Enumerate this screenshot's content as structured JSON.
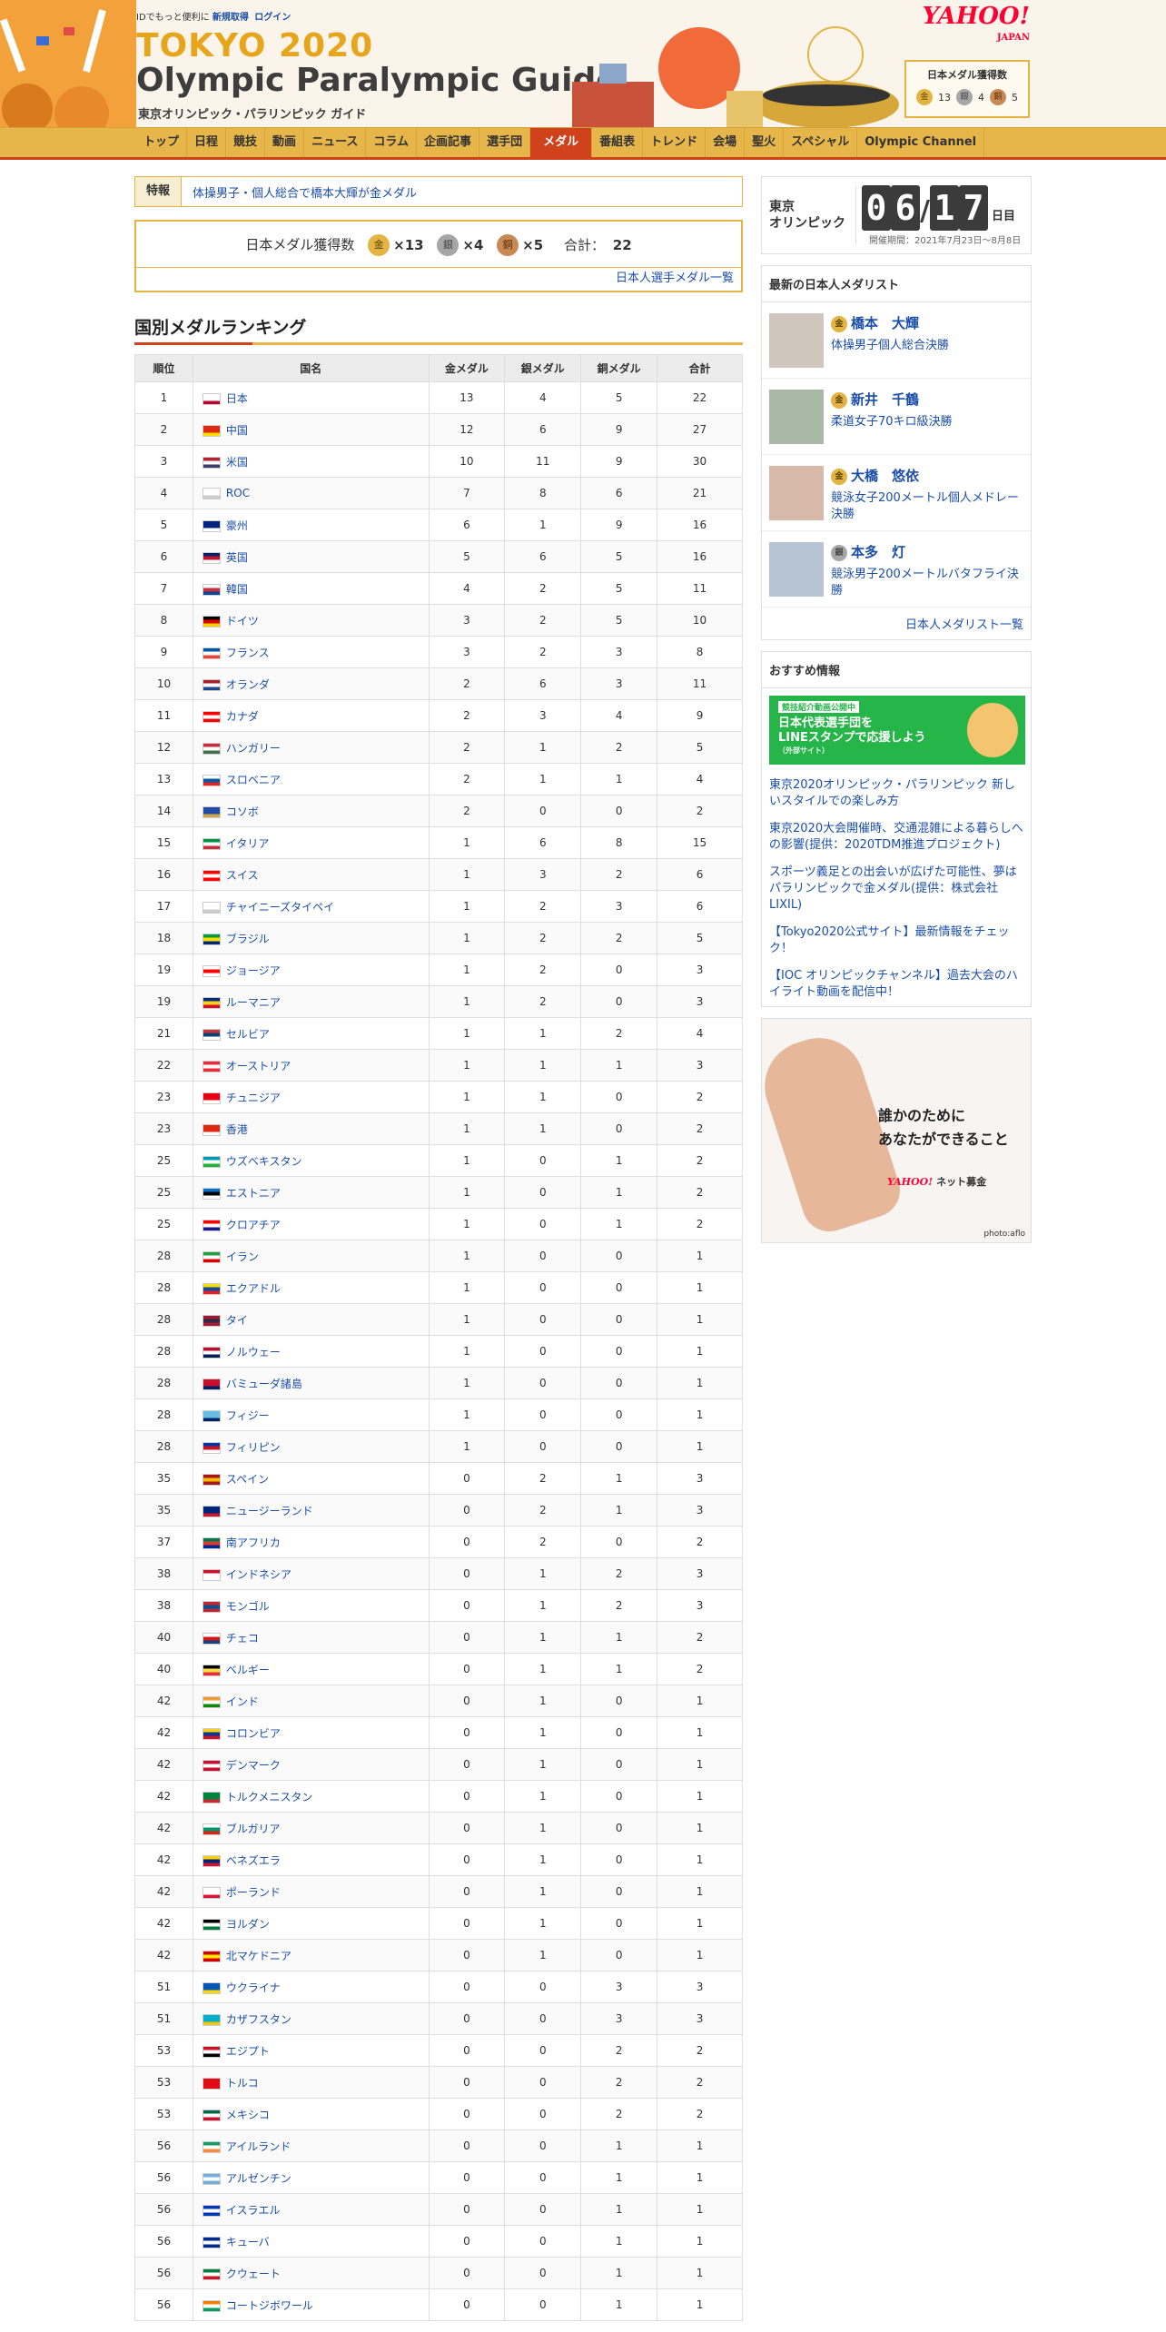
{
  "header": {
    "id_text": "IDでもっと便利に",
    "signup": "新規取得",
    "login": "ログイン",
    "logo_line1": "TOKYO 2020",
    "logo_line2": "Olympic Paralympic Guide",
    "logo_sub": "東京オリンピック・パラリンピック ガイド",
    "yahoo": "YAHOO!",
    "yahoo_sub": "JAPAN",
    "medal_title": "日本メダル獲得数",
    "gold": "13",
    "silver": "4",
    "bronze": "5"
  },
  "nav": [
    {
      "label": "トップ"
    },
    {
      "label": "日程"
    },
    {
      "label": "競技"
    },
    {
      "label": "動画"
    },
    {
      "label": "ニュース"
    },
    {
      "label": "コラム"
    },
    {
      "label": "企画記事"
    },
    {
      "label": "選手団"
    },
    {
      "label": "メダル",
      "active": true
    },
    {
      "label": "番組表"
    },
    {
      "label": "トレンド"
    },
    {
      "label": "会場"
    },
    {
      "label": "聖火"
    },
    {
      "label": "スペシャル"
    },
    {
      "label": "Olympic Channel"
    }
  ],
  "main": {
    "tokuhou_label": "特報",
    "tokuhou_text": "体操男子・個人総合で橋本大輝が金メダル",
    "medal_box": {
      "title": "日本メダル獲得数",
      "gold": "×13",
      "silver": "×4",
      "bronze": "×5",
      "total_label": "合計：",
      "total": "22",
      "link": "日本人選手メダル一覧"
    },
    "ranking_title": "国別メダルランキング",
    "columns": [
      "順位",
      "国名",
      "金メダル",
      "銀メダル",
      "銅メダル",
      "合計"
    ],
    "rows": [
      {
        "rank": "1",
        "name": "日本",
        "g": "13",
        "s": "4",
        "b": "5",
        "t": "22",
        "flag": [
          "#ffffff",
          "#ffffff",
          "#bc002d"
        ]
      },
      {
        "rank": "2",
        "name": "中国",
        "g": "12",
        "s": "6",
        "b": "9",
        "t": "27",
        "flag": [
          "#de2910",
          "#de2910",
          "#ffde00"
        ]
      },
      {
        "rank": "3",
        "name": "米国",
        "g": "10",
        "s": "11",
        "b": "9",
        "t": "30",
        "flag": [
          "#b22234",
          "#ffffff",
          "#3c3b6e"
        ]
      },
      {
        "rank": "4",
        "name": "ROC",
        "g": "7",
        "s": "8",
        "b": "6",
        "t": "21",
        "flag": [
          "#ffffff",
          "#ffffff",
          "#cccccc"
        ]
      },
      {
        "rank": "5",
        "name": "豪州",
        "g": "6",
        "s": "1",
        "b": "9",
        "t": "16",
        "flag": [
          "#00247d",
          "#00247d",
          "#ffffff"
        ]
      },
      {
        "rank": "6",
        "name": "英国",
        "g": "5",
        "s": "6",
        "b": "5",
        "t": "16",
        "flag": [
          "#012169",
          "#c8102e",
          "#ffffff"
        ]
      },
      {
        "rank": "7",
        "name": "韓国",
        "g": "4",
        "s": "2",
        "b": "5",
        "t": "11",
        "flag": [
          "#ffffff",
          "#cd2e3a",
          "#0047a0"
        ]
      },
      {
        "rank": "8",
        "name": "ドイツ",
        "g": "3",
        "s": "2",
        "b": "5",
        "t": "10",
        "flag": [
          "#000000",
          "#dd0000",
          "#ffce00"
        ]
      },
      {
        "rank": "9",
        "name": "フランス",
        "g": "3",
        "s": "2",
        "b": "3",
        "t": "8",
        "flag": [
          "#0055a4",
          "#ffffff",
          "#ef4135"
        ]
      },
      {
        "rank": "10",
        "name": "オランダ",
        "g": "2",
        "s": "6",
        "b": "3",
        "t": "11",
        "flag": [
          "#ae1c28",
          "#ffffff",
          "#21468b"
        ]
      },
      {
        "rank": "11",
        "name": "カナダ",
        "g": "2",
        "s": "3",
        "b": "4",
        "t": "9",
        "flag": [
          "#ff0000",
          "#ffffff",
          "#ff0000"
        ]
      },
      {
        "rank": "12",
        "name": "ハンガリー",
        "g": "2",
        "s": "1",
        "b": "2",
        "t": "5",
        "flag": [
          "#cd2a3e",
          "#ffffff",
          "#436f4d"
        ]
      },
      {
        "rank": "13",
        "name": "スロベニア",
        "g": "2",
        "s": "1",
        "b": "1",
        "t": "4",
        "flag": [
          "#ffffff",
          "#005da4",
          "#ed1c24"
        ]
      },
      {
        "rank": "14",
        "name": "コソボ",
        "g": "2",
        "s": "0",
        "b": "0",
        "t": "2",
        "flag": [
          "#244aa5",
          "#244aa5",
          "#d0a650"
        ]
      },
      {
        "rank": "15",
        "name": "イタリア",
        "g": "1",
        "s": "6",
        "b": "8",
        "t": "15",
        "flag": [
          "#009246",
          "#ffffff",
          "#ce2b37"
        ]
      },
      {
        "rank": "16",
        "name": "スイス",
        "g": "1",
        "s": "3",
        "b": "2",
        "t": "6",
        "flag": [
          "#ff0000",
          "#ffffff",
          "#ff0000"
        ]
      },
      {
        "rank": "17",
        "name": "チャイニーズタイペイ",
        "g": "1",
        "s": "2",
        "b": "3",
        "t": "6",
        "flag": [
          "#ffffff",
          "#ffffff",
          "#cccccc"
        ]
      },
      {
        "rank": "18",
        "name": "ブラジル",
        "g": "1",
        "s": "2",
        "b": "2",
        "t": "5",
        "flag": [
          "#009c3b",
          "#ffdf00",
          "#002776"
        ]
      },
      {
        "rank": "19",
        "name": "ジョージア",
        "g": "1",
        "s": "2",
        "b": "0",
        "t": "3",
        "flag": [
          "#ffffff",
          "#ff0000",
          "#ffffff"
        ]
      },
      {
        "rank": "19",
        "name": "ルーマニア",
        "g": "1",
        "s": "2",
        "b": "0",
        "t": "3",
        "flag": [
          "#002b7f",
          "#fcd116",
          "#ce1126"
        ]
      },
      {
        "rank": "21",
        "name": "セルビア",
        "g": "1",
        "s": "1",
        "b": "2",
        "t": "4",
        "flag": [
          "#c6363c",
          "#0c4076",
          "#ffffff"
        ]
      },
      {
        "rank": "22",
        "name": "オーストリア",
        "g": "1",
        "s": "1",
        "b": "1",
        "t": "3",
        "flag": [
          "#ed2939",
          "#ffffff",
          "#ed2939"
        ]
      },
      {
        "rank": "23",
        "name": "チュニジア",
        "g": "1",
        "s": "1",
        "b": "0",
        "t": "2",
        "flag": [
          "#e70013",
          "#e70013",
          "#ffffff"
        ]
      },
      {
        "rank": "23",
        "name": "香港",
        "g": "1",
        "s": "1",
        "b": "0",
        "t": "2",
        "flag": [
          "#de2910",
          "#de2910",
          "#ffffff"
        ]
      },
      {
        "rank": "25",
        "name": "ウズベキスタン",
        "g": "1",
        "s": "0",
        "b": "1",
        "t": "2",
        "flag": [
          "#0099b5",
          "#ffffff",
          "#1eb53a"
        ]
      },
      {
        "rank": "25",
        "name": "エストニア",
        "g": "1",
        "s": "0",
        "b": "1",
        "t": "2",
        "flag": [
          "#0072ce",
          "#000000",
          "#ffffff"
        ]
      },
      {
        "rank": "25",
        "name": "クロアチア",
        "g": "1",
        "s": "0",
        "b": "1",
        "t": "2",
        "flag": [
          "#ff0000",
          "#ffffff",
          "#171796"
        ]
      },
      {
        "rank": "28",
        "name": "イラン",
        "g": "1",
        "s": "0",
        "b": "0",
        "t": "1",
        "flag": [
          "#239f40",
          "#ffffff",
          "#da0000"
        ]
      },
      {
        "rank": "28",
        "name": "エクアドル",
        "g": "1",
        "s": "0",
        "b": "0",
        "t": "1",
        "flag": [
          "#ffdd00",
          "#034ea2",
          "#ed1c24"
        ]
      },
      {
        "rank": "28",
        "name": "タイ",
        "g": "1",
        "s": "0",
        "b": "0",
        "t": "1",
        "flag": [
          "#a51931",
          "#2d2a4a",
          "#a51931"
        ]
      },
      {
        "rank": "28",
        "name": "ノルウェー",
        "g": "1",
        "s": "0",
        "b": "0",
        "t": "1",
        "flag": [
          "#ba0c2f",
          "#ffffff",
          "#00205b"
        ]
      },
      {
        "rank": "28",
        "name": "バミューダ諸島",
        "g": "1",
        "s": "0",
        "b": "0",
        "t": "1",
        "flag": [
          "#c8102e",
          "#c8102e",
          "#012169"
        ]
      },
      {
        "rank": "28",
        "name": "フィジー",
        "g": "1",
        "s": "0",
        "b": "0",
        "t": "1",
        "flag": [
          "#68bfe5",
          "#68bfe5",
          "#012169"
        ]
      },
      {
        "rank": "28",
        "name": "フィリピン",
        "g": "1",
        "s": "0",
        "b": "0",
        "t": "1",
        "flag": [
          "#0038a8",
          "#ce1126",
          "#ffffff"
        ]
      },
      {
        "rank": "35",
        "name": "スペイン",
        "g": "0",
        "s": "2",
        "b": "1",
        "t": "3",
        "flag": [
          "#aa151b",
          "#f1bf00",
          "#aa151b"
        ]
      },
      {
        "rank": "35",
        "name": "ニュージーランド",
        "g": "0",
        "s": "2",
        "b": "1",
        "t": "3",
        "flag": [
          "#00247d",
          "#00247d",
          "#cc142b"
        ]
      },
      {
        "rank": "37",
        "name": "南アフリカ",
        "g": "0",
        "s": "2",
        "b": "0",
        "t": "2",
        "flag": [
          "#007a4d",
          "#de3831",
          "#002395"
        ]
      },
      {
        "rank": "38",
        "name": "インドネシア",
        "g": "0",
        "s": "1",
        "b": "2",
        "t": "3",
        "flag": [
          "#ce1126",
          "#ffffff",
          "#ffffff"
        ]
      },
      {
        "rank": "38",
        "name": "モンゴル",
        "g": "0",
        "s": "1",
        "b": "2",
        "t": "3",
        "flag": [
          "#c4272f",
          "#015197",
          "#c4272f"
        ]
      },
      {
        "rank": "40",
        "name": "チェコ",
        "g": "0",
        "s": "1",
        "b": "1",
        "t": "2",
        "flag": [
          "#ffffff",
          "#d7141a",
          "#11457e"
        ]
      },
      {
        "rank": "40",
        "name": "ベルギー",
        "g": "0",
        "s": "1",
        "b": "1",
        "t": "2",
        "flag": [
          "#000000",
          "#fae042",
          "#ed2939"
        ]
      },
      {
        "rank": "42",
        "name": "インド",
        "g": "0",
        "s": "1",
        "b": "0",
        "t": "1",
        "flag": [
          "#ff9933",
          "#ffffff",
          "#138808"
        ]
      },
      {
        "rank": "42",
        "name": "コロンビア",
        "g": "0",
        "s": "1",
        "b": "0",
        "t": "1",
        "flag": [
          "#fcd116",
          "#003893",
          "#ce1126"
        ]
      },
      {
        "rank": "42",
        "name": "デンマーク",
        "g": "0",
        "s": "1",
        "b": "0",
        "t": "1",
        "flag": [
          "#c8102e",
          "#ffffff",
          "#c8102e"
        ]
      },
      {
        "rank": "42",
        "name": "トルクメニスタン",
        "g": "0",
        "s": "1",
        "b": "0",
        "t": "1",
        "flag": [
          "#00843d",
          "#00843d",
          "#d22630"
        ]
      },
      {
        "rank": "42",
        "name": "ブルガリア",
        "g": "0",
        "s": "1",
        "b": "0",
        "t": "1",
        "flag": [
          "#ffffff",
          "#00966e",
          "#d62612"
        ]
      },
      {
        "rank": "42",
        "name": "ベネズエラ",
        "g": "0",
        "s": "1",
        "b": "0",
        "t": "1",
        "flag": [
          "#ffcc00",
          "#00247d",
          "#cf142b"
        ]
      },
      {
        "rank": "42",
        "name": "ポーランド",
        "g": "0",
        "s": "1",
        "b": "0",
        "t": "1",
        "flag": [
          "#ffffff",
          "#ffffff",
          "#dc143c"
        ]
      },
      {
        "rank": "42",
        "name": "ヨルダン",
        "g": "0",
        "s": "1",
        "b": "0",
        "t": "1",
        "flag": [
          "#000000",
          "#ffffff",
          "#007a3d"
        ]
      },
      {
        "rank": "42",
        "name": "北マケドニア",
        "g": "0",
        "s": "1",
        "b": "0",
        "t": "1",
        "flag": [
          "#d20000",
          "#ffe600",
          "#d20000"
        ]
      },
      {
        "rank": "51",
        "name": "ウクライナ",
        "g": "0",
        "s": "0",
        "b": "3",
        "t": "3",
        "flag": [
          "#0057b7",
          "#0057b7",
          "#ffd700"
        ]
      },
      {
        "rank": "51",
        "name": "カザフスタン",
        "g": "0",
        "s": "0",
        "b": "3",
        "t": "3",
        "flag": [
          "#00afca",
          "#00afca",
          "#fec50c"
        ]
      },
      {
        "rank": "53",
        "name": "エジプト",
        "g": "0",
        "s": "0",
        "b": "2",
        "t": "2",
        "flag": [
          "#ce1126",
          "#ffffff",
          "#000000"
        ]
      },
      {
        "rank": "53",
        "name": "トルコ",
        "g": "0",
        "s": "0",
        "b": "2",
        "t": "2",
        "flag": [
          "#e30a17",
          "#e30a17",
          "#e30a17"
        ]
      },
      {
        "rank": "53",
        "name": "メキシコ",
        "g": "0",
        "s": "0",
        "b": "2",
        "t": "2",
        "flag": [
          "#006847",
          "#ffffff",
          "#ce1126"
        ]
      },
      {
        "rank": "56",
        "name": "アイルランド",
        "g": "0",
        "s": "0",
        "b": "1",
        "t": "1",
        "flag": [
          "#169b62",
          "#ffffff",
          "#ff883e"
        ]
      },
      {
        "rank": "56",
        "name": "アルゼンチン",
        "g": "0",
        "s": "0",
        "b": "1",
        "t": "1",
        "flag": [
          "#74acdf",
          "#ffffff",
          "#74acdf"
        ]
      },
      {
        "rank": "56",
        "name": "イスラエル",
        "g": "0",
        "s": "0",
        "b": "1",
        "t": "1",
        "flag": [
          "#0038b8",
          "#ffffff",
          "#0038b8"
        ]
      },
      {
        "rank": "56",
        "name": "キューバ",
        "g": "0",
        "s": "0",
        "b": "1",
        "t": "1",
        "flag": [
          "#002a8f",
          "#ffffff",
          "#002a8f"
        ]
      },
      {
        "rank": "56",
        "name": "クウェート",
        "g": "0",
        "s": "0",
        "b": "1",
        "t": "1",
        "flag": [
          "#007a3d",
          "#ffffff",
          "#ce1126"
        ]
      },
      {
        "rank": "56",
        "name": "コートジボワール",
        "g": "0",
        "s": "0",
        "b": "1",
        "t": "1",
        "flag": [
          "#f77f00",
          "#ffffff",
          "#009e60"
        ]
      }
    ]
  },
  "side": {
    "countdown_label": "東京\nオリンピック",
    "d1": "0",
    "d2": "6",
    "slash": "/",
    "d3": "1",
    "d4": "7",
    "day_unit": "日目",
    "period": "開催期間：2021年7月23日〜8月8日",
    "medalists_title": "最新の日本人メダリスト",
    "medalists": [
      {
        "name": "橋本　大輝",
        "event": "体操男子個人総合決勝",
        "medal": "金"
      },
      {
        "name": "新井　千鶴",
        "event": "柔道女子70キロ級決勝",
        "medal": "金"
      },
      {
        "name": "大橋　悠依",
        "event": "競泳女子200メートル個人メドレー決勝",
        "medal": "金"
      },
      {
        "name": "本多　灯",
        "event": "競泳男子200メートルバタフライ決勝",
        "medal": "銀"
      }
    ],
    "medalists_link": "日本人メダリスト一覧",
    "reco_title": "おすすめ情報",
    "banner": {
      "tag": "競技紹介動画公開中",
      "text": "日本代表選手団を\nLINEスタンプで応援しよう",
      "sub": "（外部サイト）"
    },
    "reco_links": [
      "東京2020オリンピック・パラリンピック 新しいスタイルでの楽しみ方",
      "東京2020大会開催時、交通混雑による暮らしへの影響(提供：2020TDM推進プロジェクト)",
      "スポーツ義足との出会いが広げた可能性、夢はパラリンピックで金メダル(提供：株式会社LIXIL)",
      "【Tokyo2020公式サイト】最新情報をチェック！",
      "【IOC オリンピックチャンネル】過去大会のハイライト動画を配信中！"
    ],
    "ad": {
      "copy1": "誰かのために",
      "copy2": "あなたができること",
      "brand": "YAHOO!",
      "brand_sub": "ネット募金",
      "credit": "photo:aflo"
    }
  },
  "colors": {
    "gold": "#e3b443",
    "silver": "#a6a6a6",
    "bronze": "#c78a54",
    "nav_bg": "#e6b64a",
    "accent": "#d0421b"
  }
}
